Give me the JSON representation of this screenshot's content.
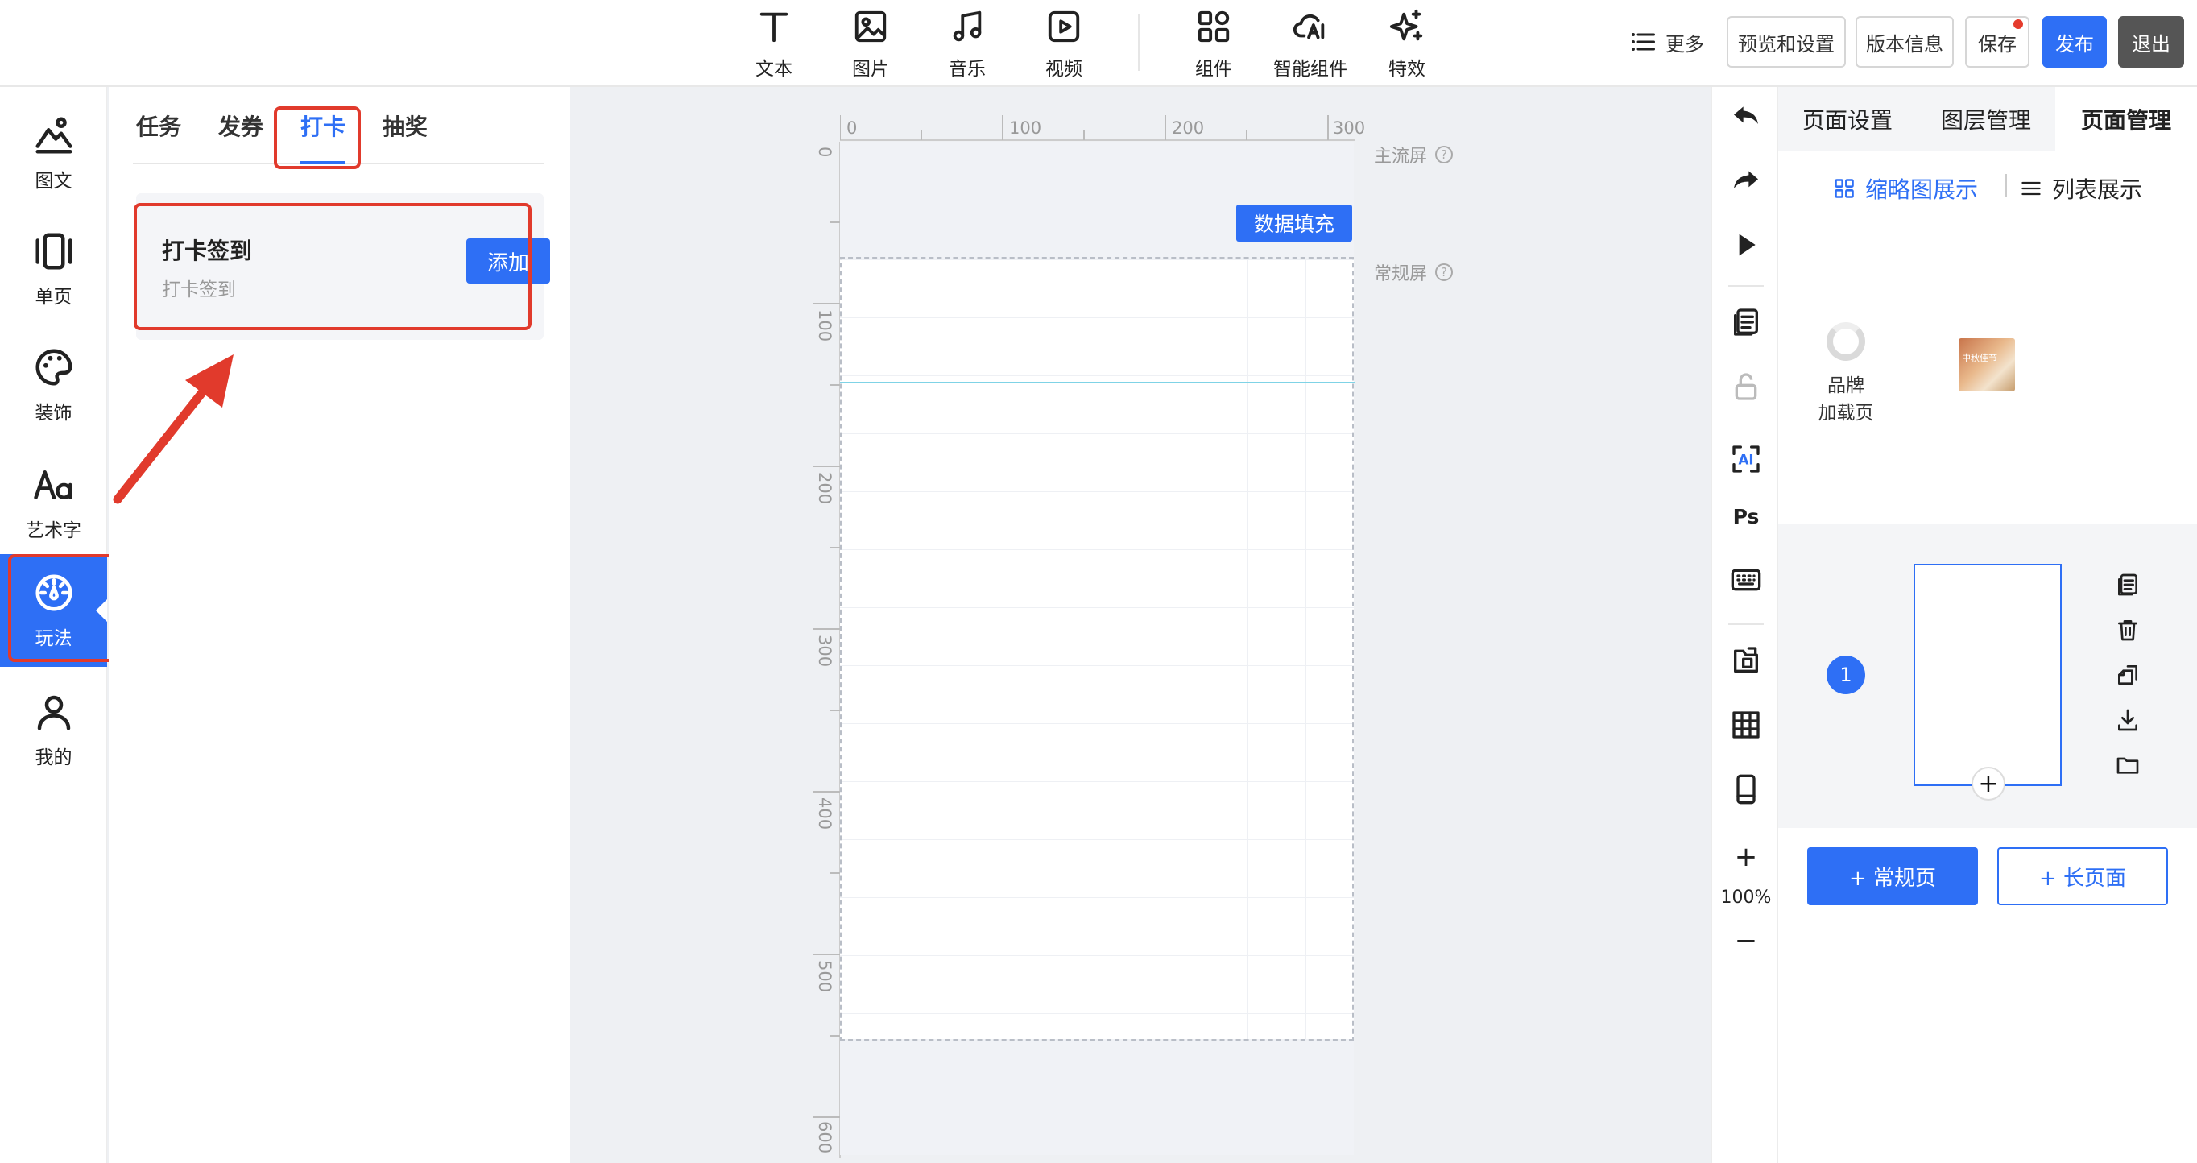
{
  "toolbar": {
    "tools": [
      "文本",
      "图片",
      "音乐",
      "视频",
      "组件",
      "智能组件",
      "特效"
    ],
    "more": "更多",
    "preview": "预览和设置",
    "version": "版本信息",
    "save": "保存",
    "publish": "发布",
    "exit": "退出"
  },
  "leftnav": {
    "items": [
      "图文",
      "单页",
      "装饰",
      "艺术字",
      "玩法",
      "我的"
    ],
    "active": "玩法"
  },
  "panel": {
    "tabs": [
      "任务",
      "发券",
      "打卡",
      "抽奖"
    ],
    "active_tab": "打卡",
    "card": {
      "title": "打卡签到",
      "subtitle": "打卡签到",
      "add": "添加"
    }
  },
  "canvas": {
    "ruler_h": [
      "0",
      "100",
      "200",
      "300"
    ],
    "ruler_v": [
      "0",
      "100",
      "200",
      "300",
      "400",
      "500",
      "600"
    ],
    "main_screen": "主流屏",
    "normal_screen": "常规屏",
    "data_fill": "数据填充",
    "help_glyph": "?"
  },
  "righttools": {
    "ai": "AI",
    "ps": "Ps",
    "zoom_in": "+",
    "zoom": "100%",
    "zoom_out": "−"
  },
  "rightpanel": {
    "tabs": [
      "页面设置",
      "图层管理",
      "页面管理"
    ],
    "active_tab": "页面管理",
    "view_thumb": "缩略图展示",
    "view_list": "列表展示",
    "load_page_l1": "品牌",
    "load_page_l2": "加载页",
    "thumb_text": "中秋佳节",
    "page_number": "1",
    "add_thumb": "+",
    "add_normal": "+ 常规页",
    "add_long": "+ 长页面"
  },
  "colors": {
    "accent": "#2e6ff5",
    "highlight": "#e13a2c",
    "guide": "#7fd3e6"
  }
}
